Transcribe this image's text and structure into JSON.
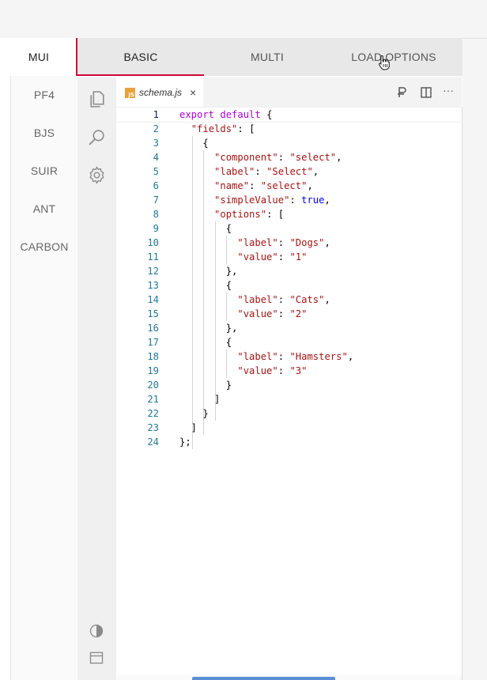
{
  "library_tabs": {
    "items": [
      {
        "label": "MUI",
        "active": true
      },
      {
        "label": "PF4"
      },
      {
        "label": "BJS"
      },
      {
        "label": "SUIR"
      },
      {
        "label": "ANT"
      },
      {
        "label": "CARBON"
      }
    ]
  },
  "schema_tabs": {
    "items": [
      {
        "label": "BASIC",
        "active": true
      },
      {
        "label": "MULTI"
      },
      {
        "label": "LOAD OPTIONS"
      }
    ]
  },
  "activity_bar": {
    "icons": [
      "files-icon",
      "search-icon",
      "gear-icon",
      "contrast-icon",
      "panel-layout-icon"
    ]
  },
  "editor": {
    "file_tab": {
      "badge": "JS",
      "name": "schema.js",
      "close": "×"
    },
    "toolbar": {
      "more": "···"
    },
    "current_line": 1,
    "line_numbers": [
      "1",
      "2",
      "3",
      "4",
      "5",
      "6",
      "7",
      "8",
      "9",
      "10",
      "11",
      "12",
      "13",
      "14",
      "15",
      "16",
      "17",
      "18",
      "19",
      "20",
      "21",
      "22",
      "23",
      "24"
    ],
    "code_lines": [
      "export default {",
      "  \"fields\": [",
      "    {",
      "      \"component\": \"select\",",
      "      \"label\": \"Select\",",
      "      \"name\": \"select\",",
      "      \"simpleValue\": true,",
      "      \"options\": [",
      "        {",
      "          \"label\": \"Dogs\",",
      "          \"value\": \"1\"",
      "        },",
      "        {",
      "          \"label\": \"Cats\",",
      "          \"value\": \"2\"",
      "        },",
      "        {",
      "          \"label\": \"Hamsters\",",
      "          \"value\": \"3\"",
      "        }",
      "      ]",
      "    }",
      "  ]",
      "};"
    ]
  },
  "colors": {
    "accent": "#d0073a",
    "keyword": "#af00db",
    "string": "#a31515",
    "boolean": "#0000ff",
    "line_number": "#237893"
  }
}
